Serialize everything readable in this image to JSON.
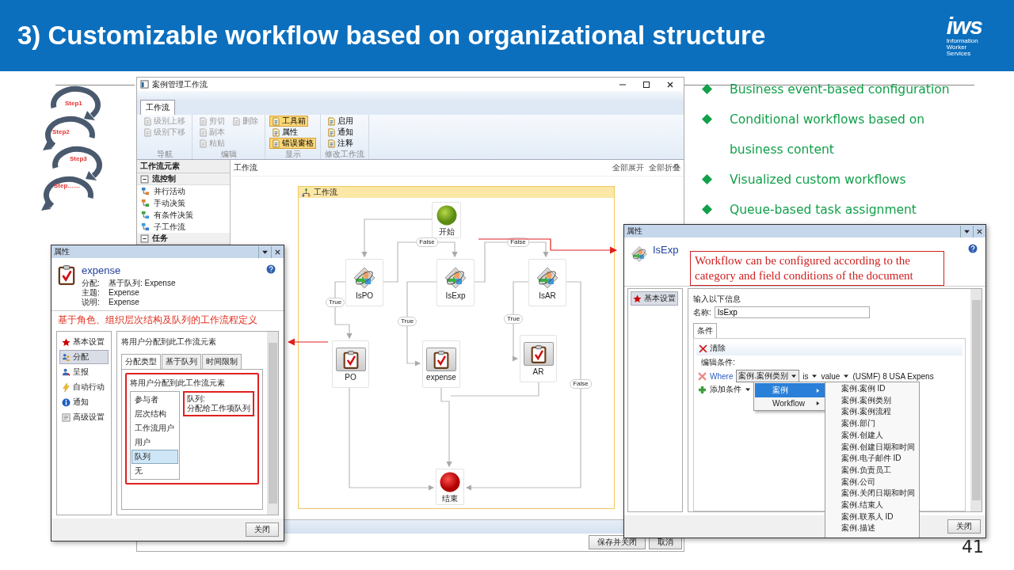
{
  "slide": {
    "title": "3) Customizable workflow based on organizational structure",
    "logo": {
      "mark": "iws",
      "tagline": [
        "Information",
        "Worker",
        "Services"
      ]
    },
    "page_number": "41"
  },
  "steps": [
    "Step1",
    "Step2",
    "Step3",
    "Step……"
  ],
  "bullets": [
    {
      "lines": [
        "Business event-based configuration"
      ]
    },
    {
      "lines": [
        "Conditional workflows based on",
        "business content"
      ]
    },
    {
      "lines": [
        "Visualized custom workflows"
      ]
    },
    {
      "lines": [
        "Queue-based task assignment"
      ]
    }
  ],
  "main_window": {
    "title": "案例管理工作流",
    "ribbon_tabs": [
      {
        "label": "工作流",
        "selected": true
      }
    ],
    "ribbon_groups": [
      {
        "label": "导航",
        "rows": [
          [
            {
              "label": "级别上移",
              "disabled": true,
              "selected": false
            }
          ],
          [
            {
              "label": "级别下移",
              "disabled": true,
              "selected": false
            }
          ]
        ]
      },
      {
        "label": "编辑",
        "rows": [
          [
            {
              "label": "剪切",
              "disabled": true,
              "selected": false
            },
            {
              "label": "删除",
              "disabled": true,
              "selected": false
            }
          ],
          [
            {
              "label": "副本",
              "disabled": true,
              "selected": false
            }
          ],
          [
            {
              "label": "粘贴",
              "disabled": true,
              "selected": false
            }
          ]
        ]
      },
      {
        "label": "显示",
        "rows": [
          [
            {
              "label": "工具箱",
              "disabled": false,
              "selected": true
            }
          ],
          [
            {
              "label": "属性",
              "disabled": false,
              "selected": false
            }
          ],
          [
            {
              "label": "错误窗格",
              "disabled": false,
              "selected": true
            }
          ]
        ]
      },
      {
        "label": "修改工作流",
        "rows": [
          [
            {
              "label": "启用",
              "disabled": false,
              "selected": false
            }
          ],
          [
            {
              "label": "通知",
              "disabled": false,
              "selected": false
            }
          ],
          [
            {
              "label": "注释",
              "disabled": false,
              "selected": false
            }
          ]
        ]
      }
    ],
    "toolbox": {
      "title": "工作流元素",
      "groups": [
        {
          "label": "流控制",
          "expanded": true,
          "items": [
            "并行活动",
            "手动决策",
            "有条件决策",
            "子工作流"
          ]
        },
        {
          "label": "任务",
          "expanded": true
        }
      ]
    },
    "canvas": {
      "breadcrumb": "工作流",
      "actions": [
        "全部展开",
        "全部折叠"
      ],
      "container_title": "工作流",
      "nodes": [
        {
          "kind": "start",
          "label": "开始"
        },
        {
          "kind": "decision",
          "label": "IsPO"
        },
        {
          "kind": "decision",
          "label": "IsExp"
        },
        {
          "kind": "decision",
          "label": "IsAR"
        },
        {
          "kind": "task",
          "label": "PO"
        },
        {
          "kind": "task",
          "label": "expense"
        },
        {
          "kind": "task",
          "label": "AR"
        },
        {
          "kind": "end",
          "label": "结束"
        }
      ],
      "edge_labels": [
        "False",
        "False",
        "True",
        "True",
        "True",
        "False"
      ]
    },
    "footer_buttons": [
      "保存并关闭",
      "取消"
    ]
  },
  "left_dialog": {
    "title": "属性",
    "name": "expense",
    "fields": [
      {
        "label": "分配:",
        "value": "基于队列: Expense"
      },
      {
        "label": "主题:",
        "value": "Expense"
      },
      {
        "label": "说明:",
        "value": "Expense"
      }
    ],
    "annotation": "基于角色、组织层次结构及队列的工作流程定义",
    "nav": [
      {
        "label": "基本设置",
        "selected": false
      },
      {
        "label": "分配",
        "selected": true
      },
      {
        "label": "呈报",
        "selected": false
      },
      {
        "label": "自动行动",
        "selected": false
      },
      {
        "label": "通知",
        "selected": false
      },
      {
        "label": "高级设置",
        "selected": false
      }
    ],
    "panel_heading": "将用户分配到此工作流元素",
    "tabs": [
      {
        "label": "分配类型",
        "selected": true
      },
      {
        "label": "基于队列",
        "selected": false
      },
      {
        "label": "时间限制",
        "selected": false
      }
    ],
    "group_heading": "将用户分配到此工作流元素",
    "assign_types": [
      {
        "label": "参与者",
        "selected": false
      },
      {
        "label": "层次结构",
        "selected": false
      },
      {
        "label": "工作流用户",
        "selected": false
      },
      {
        "label": "用户",
        "selected": false
      },
      {
        "label": "队列",
        "selected": true
      },
      {
        "label": "无",
        "selected": false
      }
    ],
    "description": [
      "队列:",
      "分配给工作项队列"
    ],
    "close_button": "关闭"
  },
  "right_dialog": {
    "title": "属性",
    "name": "IsExp",
    "annotation": "Workflow can be configured according to the category and field conditions of the document",
    "nav": [
      {
        "label": "基本设置",
        "selected": true
      }
    ],
    "heading": "输入以下信息",
    "name_label": "名称:",
    "name_value": "IsExp",
    "tabs": [
      {
        "label": "条件",
        "selected": true
      }
    ],
    "clear_button": "清除",
    "edit_label": "编辑条件:",
    "condition": {
      "keyword": "Where",
      "field": "案例.案例类别",
      "operator": "is",
      "value_type": "value",
      "value": "(USMF) 8 USA Expens"
    },
    "add_button": "添加条件",
    "menu": [
      {
        "label": "案例",
        "selected": true
      },
      {
        "label": "Workflow",
        "selected": false
      }
    ],
    "submenu": [
      "案例.案例 ID",
      "案例.案例类别",
      "案例.案例流程",
      "案例.部门",
      "案例.创建人",
      "案例.创建日期和时间",
      "案例.电子邮件 ID",
      "案例.负责员工",
      "案例.公司",
      "案例.关闭日期和时间",
      "案例.结束人",
      "案例.联系人 ID",
      "案例.描述"
    ],
    "close_button": "关闭"
  }
}
